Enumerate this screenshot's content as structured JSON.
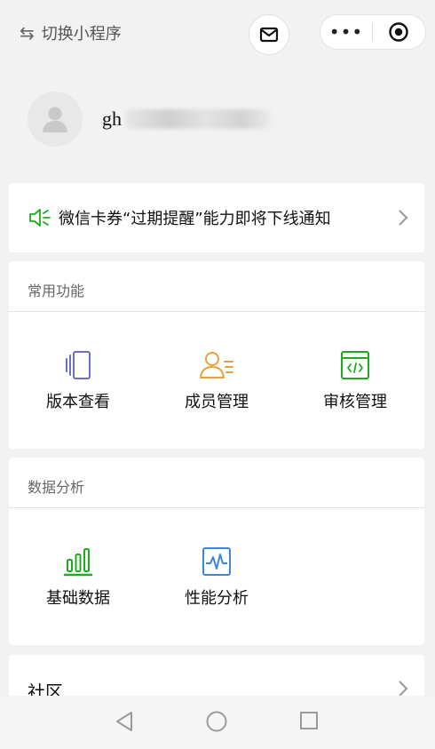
{
  "topbar": {
    "switch_label": "切换小程序",
    "switch_glyph": "⇆",
    "more_glyph": "•••"
  },
  "profile": {
    "name_prefix": "gh"
  },
  "notice": {
    "text": "微信卡券“过期提醒”能力即将下线通知"
  },
  "common_functions": {
    "title": "常用功能",
    "items": [
      {
        "label": "版本查看",
        "icon": "versions-icon"
      },
      {
        "label": "成员管理",
        "icon": "members-icon"
      },
      {
        "label": "审核管理",
        "icon": "review-code-icon"
      }
    ]
  },
  "data_analysis": {
    "title": "数据分析",
    "items": [
      {
        "label": "基础数据",
        "icon": "bar-chart-icon"
      },
      {
        "label": "性能分析",
        "icon": "performance-icon"
      }
    ]
  },
  "community": {
    "label": "社区"
  },
  "colors": {
    "background": "#f2f2f2",
    "green": "#1aad19",
    "orange": "#e8a13a",
    "blue": "#3b86d8",
    "purple": "#6b6fc7"
  }
}
